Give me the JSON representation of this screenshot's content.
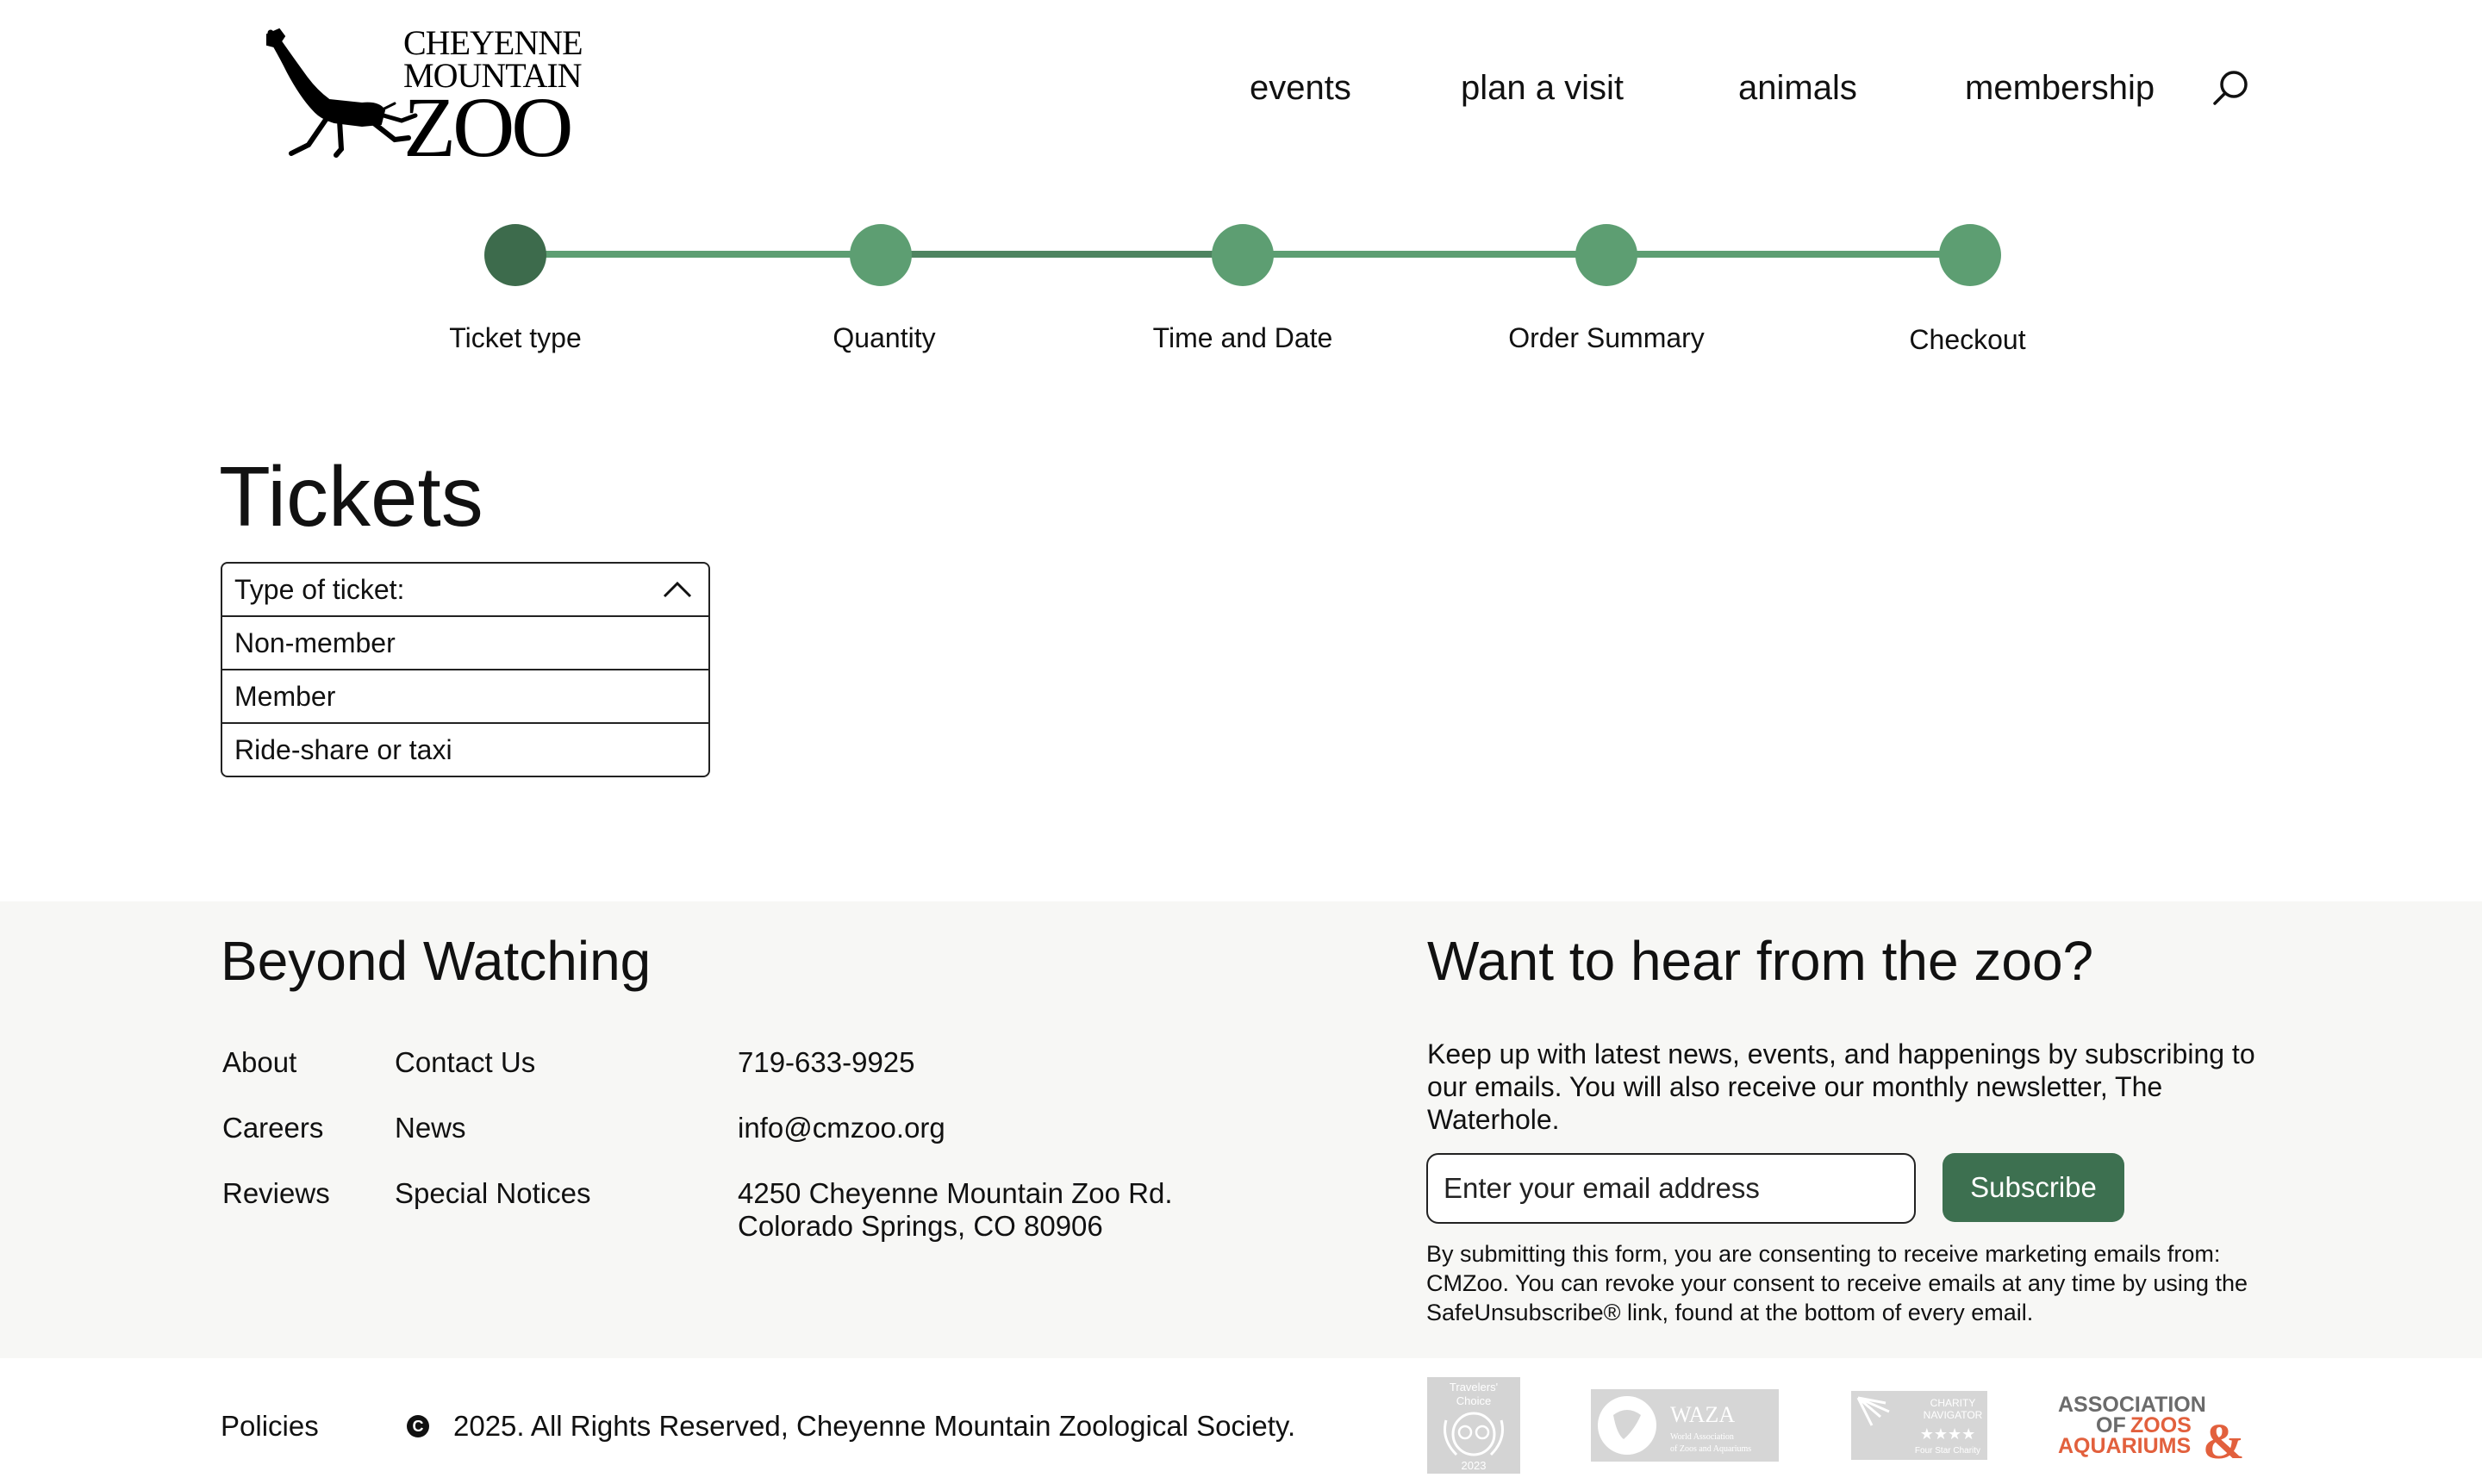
{
  "header": {
    "logo": {
      "line1": "CHEYENNE",
      "line2": "MOUNTAIN",
      "line3": "ZOO"
    },
    "nav": [
      "events",
      "plan a visit",
      "animals",
      "membership"
    ]
  },
  "stepper": {
    "steps": [
      "Ticket type",
      "Quantity",
      "Time and Date",
      "Order Summary",
      "Checkout"
    ],
    "active_index": 0
  },
  "tickets": {
    "title": "Tickets",
    "dropdown_label": "Type of ticket:",
    "options": [
      "Non-member",
      "Member",
      "Ride-share or taxi"
    ]
  },
  "footer": {
    "heading": "Beyond Watching",
    "links_col1": [
      "About",
      "Careers",
      "Reviews"
    ],
    "links_col2": [
      "Contact Us",
      "News",
      "Special Notices"
    ],
    "phone": "719-633-9925",
    "email": "info@cmzoo.org",
    "address_line1": "4250 Cheyenne Mountain Zoo Rd.",
    "address_line2": "Colorado Springs, CO 80906",
    "newsletter": {
      "heading": "Want to hear from the zoo?",
      "description": "Keep up with latest news, events, and happenings by subscribing to our emails. You will also receive our monthly newsletter, The Waterhole.",
      "email_placeholder": "Enter your email address",
      "subscribe_label": "Subscribe",
      "consent": "By submitting this form, you are consenting to receive marketing emails from: CMZoo. You can revoke your consent to receive emails at any time by using the SafeUnsubscribe® link, found at the bottom of every email."
    }
  },
  "bottom": {
    "policies": "Policies",
    "copyright_symbol": "C",
    "copyright": "2025. All Rights Reserved, Cheyenne Mountain Zoological Society.",
    "badges": {
      "tripadvisor": {
        "line1": "Travelers'",
        "line2": "Choice",
        "year": "2023"
      },
      "waza": {
        "name": "WAZA",
        "line1": "World Association",
        "line2": "of Zoos and Aquariums"
      },
      "charity": {
        "line1": "CHARITY",
        "line2": "NAVIGATOR",
        "stars": "★★★★",
        "tagline": "Four Star Charity"
      },
      "aza": {
        "line1": "ASSOCIATION",
        "line2_a": "OF",
        "line2_b": "ZOOS",
        "line3": "AQUARIUMS",
        "ampersand": "&"
      }
    }
  },
  "colors": {
    "stepper_green": "#5d9e72",
    "stepper_active": "#3d6b4c",
    "subscribe_green": "#3d7050",
    "footer_bg": "#f7f7f5",
    "aza_orange": "#e2603d",
    "aza_gray": "#6b6b6b"
  },
  "icons": {
    "search": "search-icon",
    "caret": "chevron-up-icon",
    "logo": "giraffe-logo-icon",
    "copyright": "copyright-icon"
  }
}
